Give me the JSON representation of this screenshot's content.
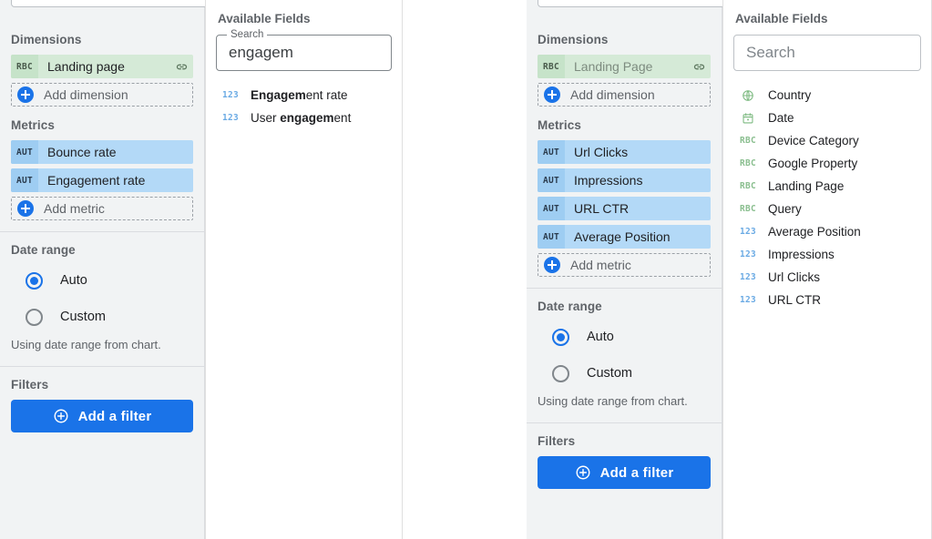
{
  "left": {
    "setup": {
      "dimensions": {
        "title": "Dimensions",
        "chips": [
          {
            "badge": "RBC",
            "label": "Landing page",
            "linked": true,
            "muted": false
          }
        ],
        "add_label": "Add dimension"
      },
      "metrics": {
        "title": "Metrics",
        "chips": [
          {
            "badge": "AUT",
            "label": "Bounce rate"
          },
          {
            "badge": "AUT",
            "label": "Engagement rate"
          }
        ],
        "add_label": "Add metric"
      },
      "date_range": {
        "title": "Date range",
        "options": [
          {
            "label": "Auto",
            "selected": true
          },
          {
            "label": "Custom",
            "selected": false
          }
        ],
        "hint": "Using date range from chart."
      },
      "filters": {
        "title": "Filters",
        "button_label": "Add a filter"
      }
    },
    "available_fields": {
      "title": "Available Fields",
      "search": {
        "floating_label": "Search",
        "value": "engagem",
        "placeholder": ""
      },
      "items": [
        {
          "icon": "123",
          "kind": "num",
          "pre": "",
          "match": "Engagem",
          "post": "ent rate"
        },
        {
          "icon": "123",
          "kind": "num",
          "pre": "User ",
          "match": "engagem",
          "post": "ent"
        }
      ]
    }
  },
  "right": {
    "setup": {
      "dimensions": {
        "title": "Dimensions",
        "chips": [
          {
            "badge": "RBC",
            "label": "Landing Page",
            "linked": true,
            "muted": true
          }
        ],
        "add_label": "Add dimension"
      },
      "metrics": {
        "title": "Metrics",
        "chips": [
          {
            "badge": "AUT",
            "label": "Url Clicks"
          },
          {
            "badge": "AUT",
            "label": "Impressions"
          },
          {
            "badge": "AUT",
            "label": "URL CTR"
          },
          {
            "badge": "AUT",
            "label": "Average Position"
          }
        ],
        "add_label": "Add metric"
      },
      "date_range": {
        "title": "Date range",
        "options": [
          {
            "label": "Auto",
            "selected": true
          },
          {
            "label": "Custom",
            "selected": false
          }
        ],
        "hint": "Using date range from chart."
      },
      "filters": {
        "title": "Filters",
        "button_label": "Add a filter"
      }
    },
    "available_fields": {
      "title": "Available Fields",
      "search": {
        "floating_label": "",
        "value": "",
        "placeholder": "Search"
      },
      "items": [
        {
          "icon": "globe",
          "kind": "geo",
          "name": "Country"
        },
        {
          "icon": "calendar",
          "kind": "date",
          "name": "Date"
        },
        {
          "icon": "RBC",
          "kind": "txt",
          "name": "Device Category"
        },
        {
          "icon": "RBC",
          "kind": "txt",
          "name": "Google Property"
        },
        {
          "icon": "RBC",
          "kind": "txt",
          "name": "Landing Page"
        },
        {
          "icon": "RBC",
          "kind": "txt",
          "name": "Query"
        },
        {
          "icon": "123",
          "kind": "num",
          "name": "Average Position"
        },
        {
          "icon": "123",
          "kind": "num",
          "name": "Impressions"
        },
        {
          "icon": "123",
          "kind": "num",
          "name": "Url Clicks"
        },
        {
          "icon": "123",
          "kind": "num",
          "name": "URL CTR"
        }
      ]
    }
  },
  "colors": {
    "accent": "#1a73e8",
    "dimension_chip": "#d5ead7",
    "metric_chip": "#b3d9f7",
    "panel_bg": "#f1f3f4"
  }
}
